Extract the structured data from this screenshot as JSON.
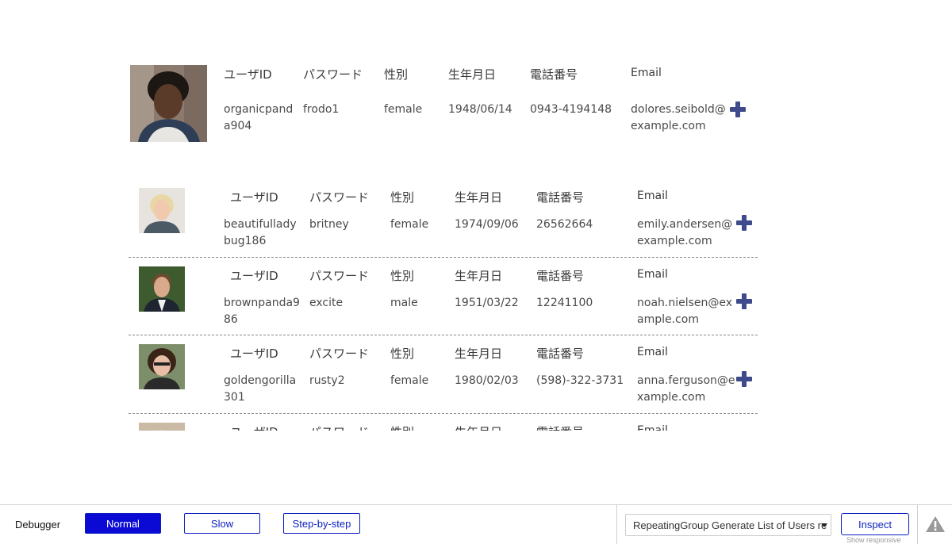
{
  "headers": {
    "user_id": "ユーザID",
    "password": "パスワード",
    "gender": "性別",
    "birthdate": "生年月日",
    "phone": "電話番号",
    "email": "Email"
  },
  "featured": {
    "user_id": [
      "organicpand",
      "a904"
    ],
    "password": "frodo1",
    "gender": "female",
    "birthdate": "1948/06/14",
    "phone": "0943-4194148",
    "email": [
      "dolores.seibold@",
      "example.com"
    ]
  },
  "users": [
    {
      "user_id": [
        "beautifullady",
        "bug186"
      ],
      "password": "britney",
      "gender": "female",
      "birthdate": "1974/09/06",
      "phone": "26562664",
      "email": [
        "emily.andersen@",
        "example.com"
      ]
    },
    {
      "user_id": [
        "brownpanda9",
        "86"
      ],
      "password": "excite",
      "gender": "male",
      "birthdate": "1951/03/22",
      "phone": "12241100",
      "email": [
        "noah.nielsen@ex",
        "ample.com"
      ]
    },
    {
      "user_id": [
        "goldengorilla",
        "301"
      ],
      "password": "rusty2",
      "gender": "female",
      "birthdate": "1980/02/03",
      "phone": "(598)-322-3731",
      "email": [
        "anna.ferguson@e",
        "xample.com"
      ]
    },
    {
      "user_id": [
        "",
        ""
      ],
      "password": "",
      "gender": "",
      "birthdate": "",
      "phone": "",
      "email": [
        "",
        ""
      ]
    }
  ],
  "debugger": {
    "label": "Debugger",
    "modes": [
      "Normal",
      "Slow",
      "Step-by-step"
    ],
    "active_mode": "Normal",
    "element_select_value": "RepeatingGroup Generate List of Users re",
    "inspect_label": "Inspect",
    "show_responsive": "Show responsive",
    "warning_icon": "warning-triangle-icon",
    "accent_color": "#0a0ad4"
  },
  "colors": {
    "plus_icon": "#3f4a8c",
    "divider": "#8a8a8a"
  }
}
